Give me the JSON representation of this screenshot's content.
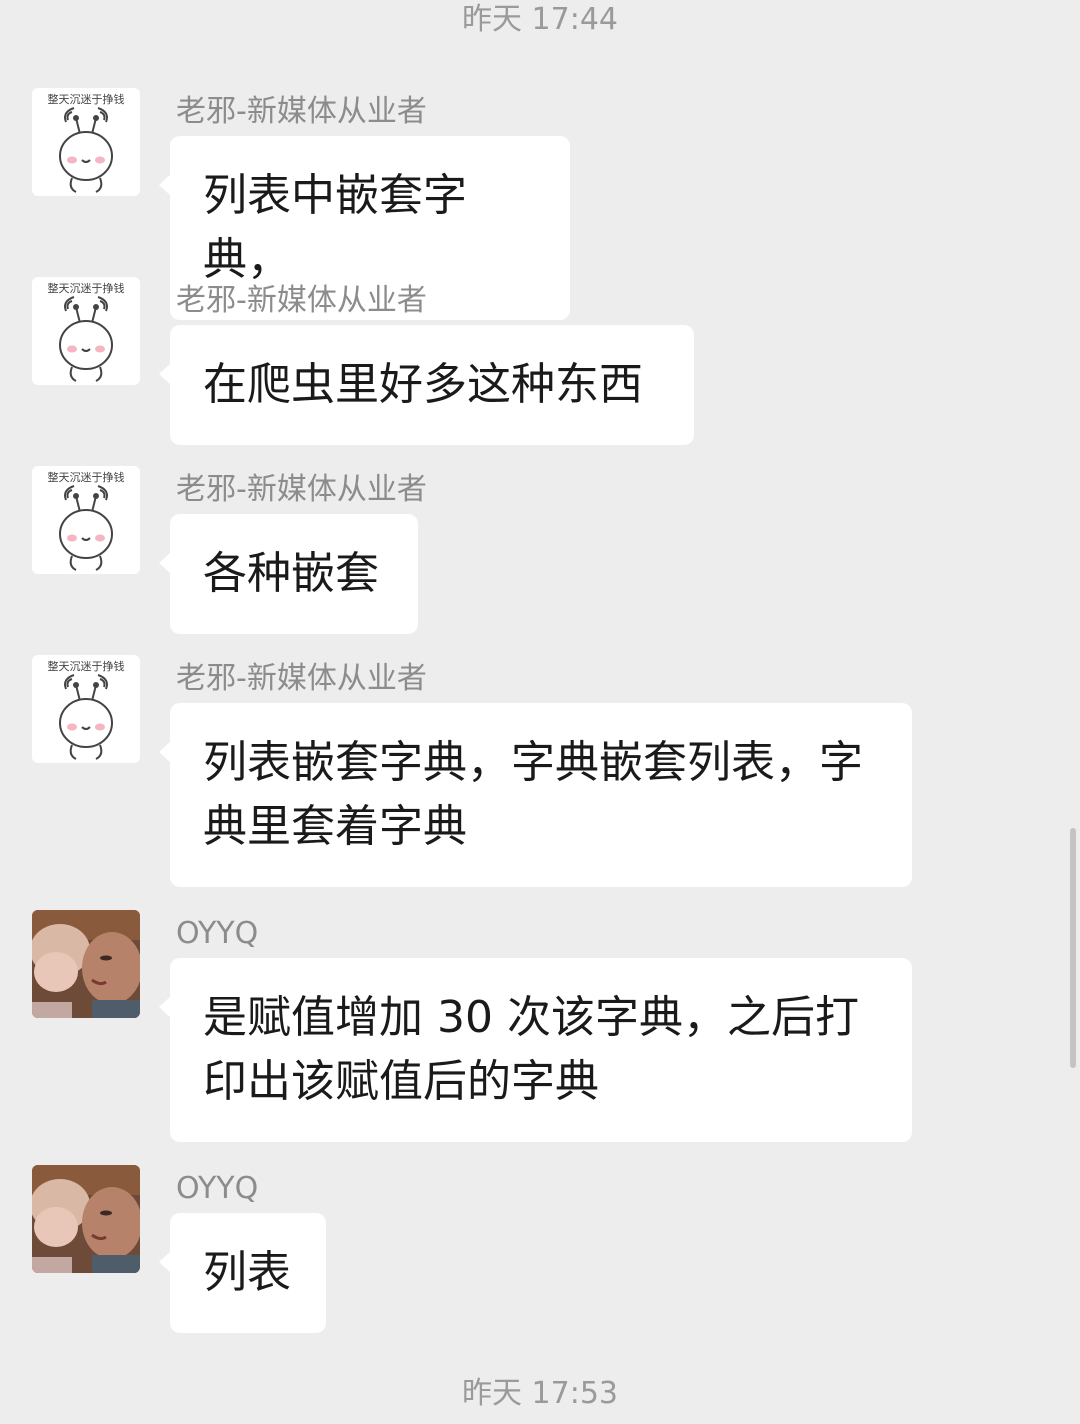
{
  "timestamps": {
    "top": "昨天 17:44",
    "bottom": "昨天 17:53"
  },
  "messages": [
    {
      "sender": "老邪-新媒体从业者",
      "avatar": "cartoon-avatar",
      "avatar_caption": "整天沉迷于挣钱",
      "text": "列表中嵌套字典，"
    },
    {
      "sender": "老邪-新媒体从业者",
      "avatar": "cartoon-avatar",
      "avatar_caption": "整天沉迷于挣钱",
      "text": "在爬虫里好多这种东西"
    },
    {
      "sender": "老邪-新媒体从业者",
      "avatar": "cartoon-avatar",
      "avatar_caption": "整天沉迷于挣钱",
      "text": "各种嵌套"
    },
    {
      "sender": "老邪-新媒体从业者",
      "avatar": "cartoon-avatar",
      "avatar_caption": "整天沉迷于挣钱",
      "text_lines": [
        "列表嵌套字典，字典嵌套列表，字",
        "典里套着字典"
      ]
    },
    {
      "sender": "OYYQ",
      "avatar": "photo-avatar",
      "text_lines": [
        "是赋值增加 30 次该字典，之后打",
        "印出该赋值后的字典"
      ]
    },
    {
      "sender": "OYYQ",
      "avatar": "photo-avatar",
      "text": "列表"
    }
  ],
  "colors": {
    "background": "#ededed",
    "bubble": "#ffffff",
    "text": "#1a1a1a",
    "meta": "#9a9a9a"
  }
}
